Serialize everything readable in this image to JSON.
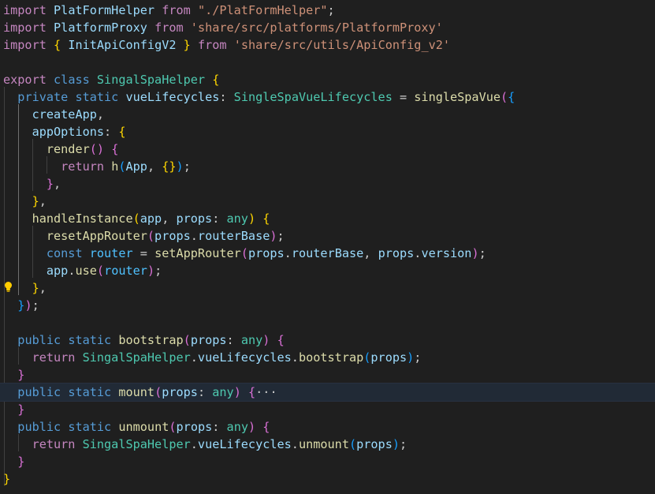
{
  "colors": {
    "background": "#1f1f1f",
    "keyword_control": "#c586c0",
    "keyword": "#569cd6",
    "class_name": "#4ec9b0",
    "function": "#dcdcaa",
    "variable": "#9cdcfe",
    "string": "#ce9178",
    "plain": "#cccccc",
    "bracket_gold": "#ffd700",
    "bracket_pink": "#da70d6",
    "bracket_blue": "#179fff",
    "constant": "#4fc1ff"
  },
  "icons": {
    "lightbulb": "lightbulb-icon"
  },
  "code": [
    {
      "tokens": [
        {
          "t": "import",
          "c": "keyword_control"
        },
        {
          "t": " "
        },
        {
          "t": "PlatFormHelper",
          "c": "variable"
        },
        {
          "t": " "
        },
        {
          "t": "from",
          "c": "keyword_control"
        },
        {
          "t": " "
        },
        {
          "t": "\"./PlatFormHelper\"",
          "c": "string"
        },
        {
          "t": ";"
        }
      ]
    },
    {
      "tokens": [
        {
          "t": "import",
          "c": "keyword_control"
        },
        {
          "t": " "
        },
        {
          "t": "PlatformProxy",
          "c": "variable"
        },
        {
          "t": " "
        },
        {
          "t": "from",
          "c": "keyword_control"
        },
        {
          "t": " "
        },
        {
          "t": "'share/src/platforms/PlatformProxy'",
          "c": "string"
        }
      ]
    },
    {
      "tokens": [
        {
          "t": "import",
          "c": "keyword_control"
        },
        {
          "t": " "
        },
        {
          "t": "{",
          "c": "bracket_gold"
        },
        {
          "t": " "
        },
        {
          "t": "InitApiConfigV2",
          "c": "variable"
        },
        {
          "t": " "
        },
        {
          "t": "}",
          "c": "bracket_gold"
        },
        {
          "t": " "
        },
        {
          "t": "from",
          "c": "keyword_control"
        },
        {
          "t": " "
        },
        {
          "t": "'share/src/utils/ApiConfig_v2'",
          "c": "string"
        }
      ]
    },
    {
      "tokens": []
    },
    {
      "tokens": [
        {
          "t": "export",
          "c": "keyword_control"
        },
        {
          "t": " "
        },
        {
          "t": "class",
          "c": "keyword"
        },
        {
          "t": " "
        },
        {
          "t": "SingalSpaHelper",
          "c": "class_name"
        },
        {
          "t": " "
        },
        {
          "t": "{",
          "c": "bracket_gold"
        }
      ]
    },
    {
      "tokens": [
        {
          "t": "  "
        },
        {
          "t": "private",
          "c": "keyword"
        },
        {
          "t": " "
        },
        {
          "t": "static",
          "c": "keyword"
        },
        {
          "t": " "
        },
        {
          "t": "vueLifecycles",
          "c": "variable"
        },
        {
          "t": ": "
        },
        {
          "t": "SingleSpaVueLifecycles",
          "c": "class_name"
        },
        {
          "t": " = "
        },
        {
          "t": "singleSpaVue",
          "c": "function"
        },
        {
          "t": "(",
          "c": "bracket_pink"
        },
        {
          "t": "{",
          "c": "bracket_blue"
        }
      ]
    },
    {
      "tokens": [
        {
          "t": "    "
        },
        {
          "t": "createApp",
          "c": "variable"
        },
        {
          "t": ","
        }
      ]
    },
    {
      "tokens": [
        {
          "t": "    "
        },
        {
          "t": "appOptions",
          "c": "variable"
        },
        {
          "t": ": "
        },
        {
          "t": "{",
          "c": "bracket_gold"
        }
      ]
    },
    {
      "tokens": [
        {
          "t": "      "
        },
        {
          "t": "render",
          "c": "function"
        },
        {
          "t": "()",
          "c": "bracket_pink"
        },
        {
          "t": " "
        },
        {
          "t": "{",
          "c": "bracket_pink"
        }
      ]
    },
    {
      "tokens": [
        {
          "t": "        "
        },
        {
          "t": "return",
          "c": "keyword_control"
        },
        {
          "t": " "
        },
        {
          "t": "h",
          "c": "function"
        },
        {
          "t": "(",
          "c": "bracket_blue"
        },
        {
          "t": "App",
          "c": "variable"
        },
        {
          "t": ", "
        },
        {
          "t": "{}",
          "c": "bracket_gold"
        },
        {
          "t": ")",
          "c": "bracket_blue"
        },
        {
          "t": ";"
        }
      ]
    },
    {
      "tokens": [
        {
          "t": "      "
        },
        {
          "t": "}",
          "c": "bracket_pink"
        },
        {
          "t": ","
        }
      ]
    },
    {
      "tokens": [
        {
          "t": "    "
        },
        {
          "t": "}",
          "c": "bracket_gold"
        },
        {
          "t": ","
        }
      ]
    },
    {
      "tokens": [
        {
          "t": "    "
        },
        {
          "t": "handleInstance",
          "c": "function"
        },
        {
          "t": "(",
          "c": "bracket_gold"
        },
        {
          "t": "app",
          "c": "variable"
        },
        {
          "t": ", "
        },
        {
          "t": "props",
          "c": "variable"
        },
        {
          "t": ": "
        },
        {
          "t": "any",
          "c": "class_name"
        },
        {
          "t": ")",
          "c": "bracket_gold"
        },
        {
          "t": " "
        },
        {
          "t": "{",
          "c": "bracket_gold"
        }
      ]
    },
    {
      "tokens": [
        {
          "t": "      "
        },
        {
          "t": "resetAppRouter",
          "c": "function"
        },
        {
          "t": "(",
          "c": "bracket_pink"
        },
        {
          "t": "props",
          "c": "variable"
        },
        {
          "t": "."
        },
        {
          "t": "routerBase",
          "c": "variable"
        },
        {
          "t": ")",
          "c": "bracket_pink"
        },
        {
          "t": ";"
        }
      ]
    },
    {
      "tokens": [
        {
          "t": "      "
        },
        {
          "t": "const",
          "c": "keyword"
        },
        {
          "t": " "
        },
        {
          "t": "router",
          "c": "constant"
        },
        {
          "t": " = "
        },
        {
          "t": "setAppRouter",
          "c": "function"
        },
        {
          "t": "(",
          "c": "bracket_pink"
        },
        {
          "t": "props",
          "c": "variable"
        },
        {
          "t": "."
        },
        {
          "t": "routerBase",
          "c": "variable"
        },
        {
          "t": ", "
        },
        {
          "t": "props",
          "c": "variable"
        },
        {
          "t": "."
        },
        {
          "t": "version",
          "c": "variable"
        },
        {
          "t": ")",
          "c": "bracket_pink"
        },
        {
          "t": ";"
        }
      ]
    },
    {
      "tokens": [
        {
          "t": "      "
        },
        {
          "t": "app",
          "c": "variable"
        },
        {
          "t": "."
        },
        {
          "t": "use",
          "c": "function"
        },
        {
          "t": "(",
          "c": "bracket_pink"
        },
        {
          "t": "router",
          "c": "constant"
        },
        {
          "t": ")",
          "c": "bracket_pink"
        },
        {
          "t": ";"
        }
      ]
    },
    {
      "tokens": [
        {
          "t": "    "
        },
        {
          "t": "}",
          "c": "bracket_gold"
        },
        {
          "t": ","
        }
      ]
    },
    {
      "tokens": [
        {
          "t": "  "
        },
        {
          "t": "}",
          "c": "bracket_blue"
        },
        {
          "t": ")",
          "c": "bracket_pink"
        },
        {
          "t": ";"
        }
      ]
    },
    {
      "tokens": []
    },
    {
      "tokens": [
        {
          "t": "  "
        },
        {
          "t": "public",
          "c": "keyword"
        },
        {
          "t": " "
        },
        {
          "t": "static",
          "c": "keyword"
        },
        {
          "t": " "
        },
        {
          "t": "bootstrap",
          "c": "function"
        },
        {
          "t": "(",
          "c": "bracket_pink"
        },
        {
          "t": "props",
          "c": "variable"
        },
        {
          "t": ": "
        },
        {
          "t": "any",
          "c": "class_name"
        },
        {
          "t": ")",
          "c": "bracket_pink"
        },
        {
          "t": " "
        },
        {
          "t": "{",
          "c": "bracket_pink"
        }
      ]
    },
    {
      "tokens": [
        {
          "t": "    "
        },
        {
          "t": "return",
          "c": "keyword_control"
        },
        {
          "t": " "
        },
        {
          "t": "SingalSpaHelper",
          "c": "class_name"
        },
        {
          "t": "."
        },
        {
          "t": "vueLifecycles",
          "c": "variable"
        },
        {
          "t": "."
        },
        {
          "t": "bootstrap",
          "c": "function"
        },
        {
          "t": "(",
          "c": "bracket_blue"
        },
        {
          "t": "props",
          "c": "variable"
        },
        {
          "t": ")",
          "c": "bracket_blue"
        },
        {
          "t": ";"
        }
      ]
    },
    {
      "tokens": [
        {
          "t": "  "
        },
        {
          "t": "}",
          "c": "bracket_pink"
        }
      ]
    },
    {
      "highlight": true,
      "tokens": [
        {
          "t": "  "
        },
        {
          "t": "public",
          "c": "keyword"
        },
        {
          "t": " "
        },
        {
          "t": "static",
          "c": "keyword"
        },
        {
          "t": " "
        },
        {
          "t": "mount",
          "c": "function"
        },
        {
          "t": "(",
          "c": "bracket_pink"
        },
        {
          "t": "props",
          "c": "variable"
        },
        {
          "t": ": "
        },
        {
          "t": "any",
          "c": "class_name"
        },
        {
          "t": ")",
          "c": "bracket_pink"
        },
        {
          "t": " "
        },
        {
          "t": "{",
          "c": "bracket_pink"
        },
        {
          "t": "···",
          "c": "plain"
        }
      ]
    },
    {
      "tokens": [
        {
          "t": "  "
        },
        {
          "t": "}",
          "c": "bracket_pink"
        }
      ]
    },
    {
      "tokens": [
        {
          "t": "  "
        },
        {
          "t": "public",
          "c": "keyword"
        },
        {
          "t": " "
        },
        {
          "t": "static",
          "c": "keyword"
        },
        {
          "t": " "
        },
        {
          "t": "unmount",
          "c": "function"
        },
        {
          "t": "(",
          "c": "bracket_pink"
        },
        {
          "t": "props",
          "c": "variable"
        },
        {
          "t": ": "
        },
        {
          "t": "any",
          "c": "class_name"
        },
        {
          "t": ")",
          "c": "bracket_pink"
        },
        {
          "t": " "
        },
        {
          "t": "{",
          "c": "bracket_pink"
        }
      ]
    },
    {
      "tokens": [
        {
          "t": "    "
        },
        {
          "t": "return",
          "c": "keyword_control"
        },
        {
          "t": " "
        },
        {
          "t": "SingalSpaHelper",
          "c": "class_name"
        },
        {
          "t": "."
        },
        {
          "t": "vueLifecycles",
          "c": "variable"
        },
        {
          "t": "."
        },
        {
          "t": "unmount",
          "c": "function"
        },
        {
          "t": "(",
          "c": "bracket_blue"
        },
        {
          "t": "props",
          "c": "variable"
        },
        {
          "t": ")",
          "c": "bracket_blue"
        },
        {
          "t": ";"
        }
      ]
    },
    {
      "tokens": [
        {
          "t": "  "
        },
        {
          "t": "}",
          "c": "bracket_pink"
        }
      ]
    },
    {
      "tokens": [
        {
          "t": "}",
          "c": "bracket_gold"
        }
      ]
    }
  ]
}
